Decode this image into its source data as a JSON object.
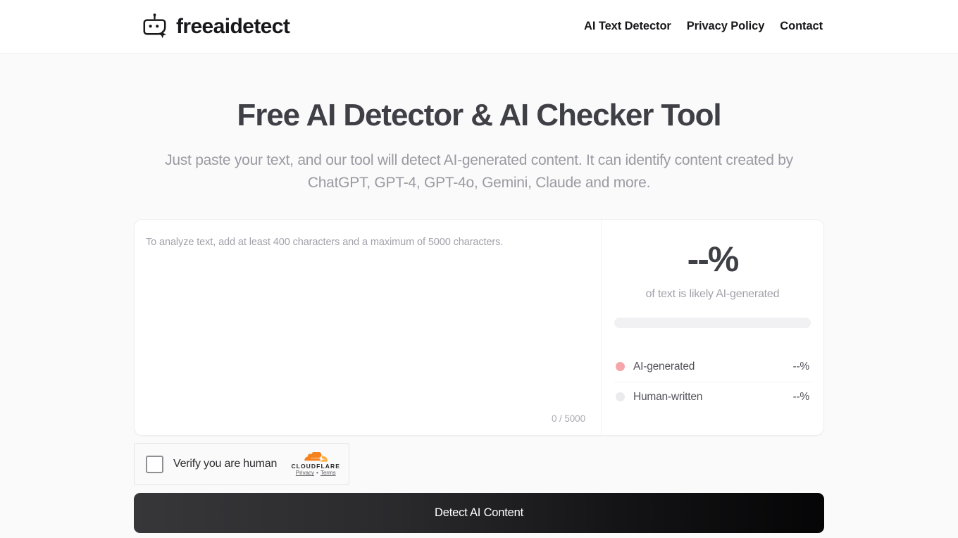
{
  "header": {
    "brand_icon": "chatbot-sparkle-icon",
    "brand_name": "freeaidetect",
    "nav": [
      {
        "label": "AI Text Detector"
      },
      {
        "label": "Privacy Policy"
      },
      {
        "label": "Contact"
      }
    ]
  },
  "hero": {
    "title": "Free AI Detector & AI Checker Tool",
    "subtitle": "Just paste your text, and our tool will detect AI-generated content. It can identify content created by ChatGPT, GPT-4, GPT-4o, Gemini, Claude and more."
  },
  "editor": {
    "placeholder": "To analyze text, add at least 400 characters and a maximum of 5000 characters.",
    "value": "",
    "char_counter": "0 / 5000"
  },
  "result": {
    "score": "--%",
    "caption": "of text is likely AI-generated",
    "bar_fill_percent": 0,
    "legend": [
      {
        "label": "AI-generated",
        "value": "--%",
        "color": "#f6a6aa"
      },
      {
        "label": "Human-written",
        "value": "--%",
        "color": "#ebebed"
      }
    ]
  },
  "turnstile": {
    "label": "Verify you are human",
    "brand": "CLOUDFLARE",
    "privacy_label": "Privacy",
    "separator": "•",
    "terms_label": "Terms",
    "cloud_color": "#f6821f"
  },
  "cta": {
    "label": "Detect AI Content"
  }
}
